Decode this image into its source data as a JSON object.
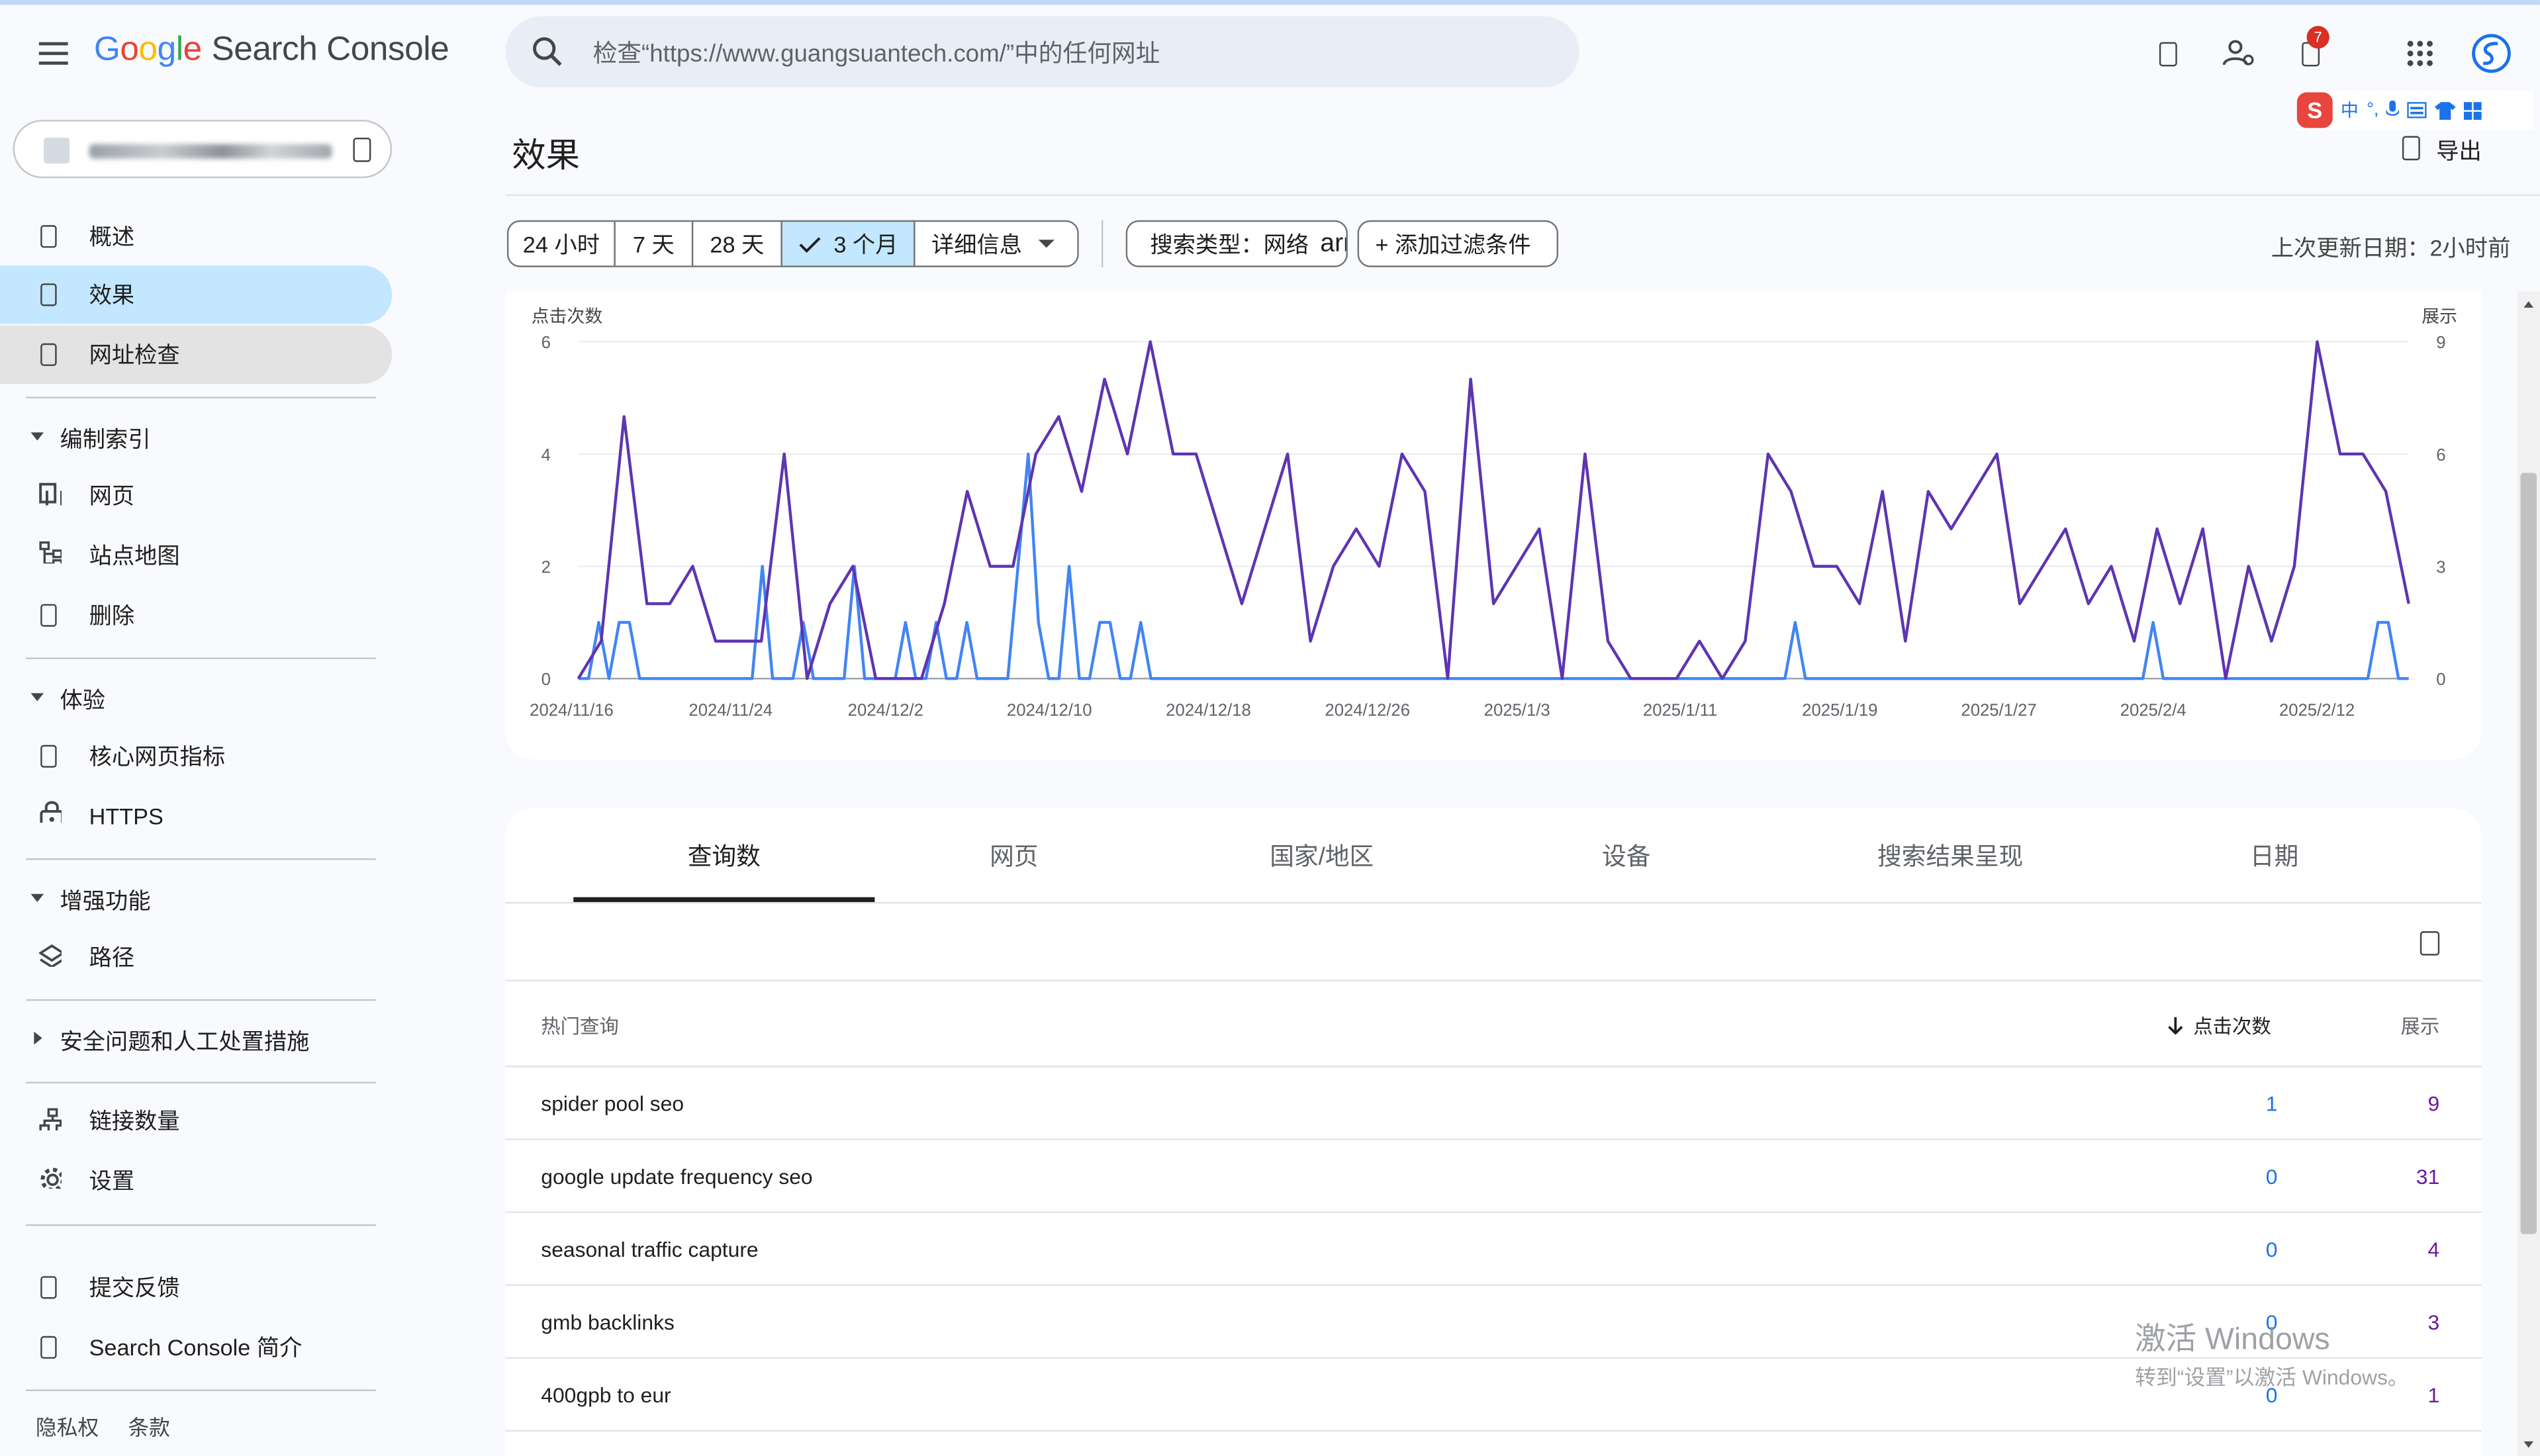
{
  "header": {
    "logo": {
      "g1": "G",
      "o1": "o",
      "o2": "o",
      "g2": "g",
      "l": "l",
      "e": "e",
      "product": "Search Console"
    },
    "search_placeholder": "检查“https://www.guangsuantech.com/”中的任何网址",
    "notification_count": "7",
    "icons": [
      "menu-icon",
      "search-icon",
      "help-icon",
      "manage-users-icon",
      "notifications-icon",
      "apps-icon",
      "account-avatar-icon"
    ]
  },
  "ime": {
    "lang": "中",
    "punct": "°,"
  },
  "sidebar": {
    "overview": "概述",
    "performance": "效果",
    "url_inspection": "网址检查",
    "indexing": {
      "title": "编制索引",
      "pages": "网页",
      "sitemaps": "站点地图",
      "removals": "删除"
    },
    "experience": {
      "title": "体验",
      "cwv": "核心网页指标",
      "https": "HTTPS"
    },
    "enhancements": {
      "title": "增强功能",
      "breadcrumbs": "路径"
    },
    "security": "安全问题和人工处置措施",
    "links": "链接数量",
    "settings": "设置",
    "feedback": "提交反馈",
    "about": "Search Console 简介",
    "privacy": "隐私权",
    "terms": "条款"
  },
  "main": {
    "title": "效果",
    "export": "导出",
    "ranges": [
      "24 小时",
      "7 天",
      "28 天",
      "3 个月"
    ],
    "selected_range_index": 3,
    "details": "详细信息",
    "search_type_chip": "搜索类型：网络",
    "chip_icon_text": "arrow_drop_down",
    "add_filter": "+ 添加过滤条件",
    "last_update": "上次更新日期：2小时前"
  },
  "chart_data": {
    "type": "line",
    "ylabel": "点击次数",
    "y2label": "展示",
    "ylim": [
      0,
      6
    ],
    "y2lim": [
      0,
      9
    ],
    "yticks": [
      0,
      2,
      4,
      6
    ],
    "y2ticks": [
      0,
      3,
      6,
      9
    ],
    "x_ticks": [
      "2024/11/16",
      "2024/11/24",
      "2024/12/2",
      "2024/12/10",
      "2024/12/18",
      "2024/12/26",
      "2025/1/3",
      "2025/1/11",
      "2025/1/19",
      "2025/1/27",
      "2025/2/4",
      "2025/2/12"
    ],
    "grid": true,
    "colors": {
      "clicks": "#4285f4",
      "impressions": "#5e35b1"
    },
    "series": [
      {
        "name": "点击次数",
        "axis": "left",
        "values": [
          0,
          0,
          1,
          0,
          1,
          1,
          0,
          0,
          0,
          0,
          0,
          0,
          0,
          0,
          0,
          0,
          0,
          0,
          2,
          0,
          0,
          0,
          1,
          0,
          0,
          0,
          0,
          2,
          0,
          0,
          0,
          0,
          1,
          0,
          0,
          1,
          0,
          0,
          1,
          0,
          0,
          0,
          0,
          2,
          4,
          1,
          0,
          0,
          2,
          0,
          0,
          1,
          1,
          0,
          0,
          1,
          0,
          0,
          0,
          0,
          0,
          0,
          0,
          0,
          0,
          0,
          0,
          0,
          0,
          0,
          0,
          0,
          0,
          0,
          0,
          0,
          0,
          0,
          0,
          0,
          0,
          0,
          0,
          0,
          0,
          0,
          0,
          0,
          0,
          0,
          0,
          0,
          0,
          0,
          0,
          0,
          0,
          0,
          0,
          0,
          0,
          0,
          0,
          0,
          0,
          0,
          0,
          0,
          0,
          0,
          0,
          0,
          0,
          0,
          0,
          0,
          0,
          0,
          0,
          1,
          0,
          0,
          0,
          0,
          0,
          0,
          0,
          0,
          0,
          0,
          0,
          0,
          0,
          0,
          0,
          0,
          0,
          0,
          0,
          0,
          0,
          0,
          0,
          0,
          0,
          0,
          0,
          0,
          0,
          0,
          0,
          0,
          0,
          0,
          1,
          0,
          0,
          0,
          0,
          0,
          0,
          0,
          0,
          0,
          0,
          0,
          0,
          0,
          0,
          0,
          0,
          0,
          0,
          0,
          0,
          0,
          1,
          1,
          0,
          0
        ]
      },
      {
        "name": "展示",
        "axis": "right",
        "values": [
          0,
          1,
          7,
          2,
          2,
          3,
          1,
          1,
          1,
          6,
          0,
          2,
          3,
          0,
          0,
          0,
          2,
          5,
          3,
          3,
          6,
          7,
          5,
          8,
          6,
          9,
          6,
          6,
          4,
          2,
          4,
          6,
          1,
          3,
          4,
          3,
          6,
          5,
          0,
          8,
          2,
          3,
          4,
          0,
          6,
          1,
          0,
          0,
          0,
          1,
          0,
          1,
          6,
          5,
          3,
          3,
          2,
          5,
          1,
          5,
          4,
          5,
          6,
          2,
          3,
          4,
          2,
          3,
          1,
          4,
          2,
          4,
          0,
          3,
          1,
          3,
          9,
          6,
          6,
          5,
          2
        ]
      }
    ]
  },
  "table": {
    "tabs": [
      "查询数",
      "网页",
      "国家/地区",
      "设备",
      "搜索结果呈现",
      "日期"
    ],
    "selected_tab": 0,
    "columns": {
      "query": "热门查询",
      "clicks": "点击次数",
      "impressions": "展示"
    },
    "rows": [
      {
        "query": "spider pool seo",
        "clicks": "1",
        "impressions": "9"
      },
      {
        "query": "google update frequency seo",
        "clicks": "0",
        "impressions": "31"
      },
      {
        "query": "seasonal traffic capture",
        "clicks": "0",
        "impressions": "4"
      },
      {
        "query": "gmb backlinks",
        "clicks": "0",
        "impressions": "3"
      },
      {
        "query": "400gpb to eur",
        "clicks": "0",
        "impressions": "1"
      }
    ]
  },
  "watermark": {
    "line1": "激活 Windows",
    "line2": "转到“设置”以激活 Windows。"
  }
}
